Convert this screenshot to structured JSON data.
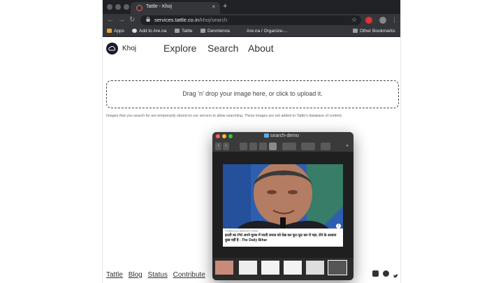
{
  "browser": {
    "tab_title": "Tattle - Khoj",
    "tab_close": "×",
    "new_tab": "+",
    "url_host": "services.tattle.co.in",
    "url_path": "/khoj/search",
    "back": "←",
    "forward": "→",
    "reload": "↻",
    "lock": "🔒",
    "star": "☆",
    "menu": "⋮",
    "bookmarks": [
      {
        "label": "Apps",
        "icon": "apps-grid-icon"
      },
      {
        "label": "Add to Are.na",
        "icon": "arena-icon"
      },
      {
        "label": "Tattle",
        "icon": "folder-icon"
      },
      {
        "label": "Denntenna",
        "icon": "folder-icon"
      },
      {
        "label": "Are.na / Organize-...",
        "icon": "page-icon"
      },
      {
        "label": "Other Bookmarks",
        "icon": "folder-icon"
      }
    ]
  },
  "site": {
    "brand": "Khoj",
    "nav": [
      "Explore",
      "Search",
      "About"
    ],
    "dropzone_text": "Drag 'n' drop your image here, or click to upload it.",
    "notice": "Images that you search for are temporarily stored on our servers to allow searching. These images are not added to Tattle's database of content.",
    "footer_links": [
      "Tattle",
      "Blog",
      "Status",
      "Contribute"
    ]
  },
  "finder": {
    "title": "search-demo",
    "back": "‹",
    "forward": "›",
    "more": "»",
    "card_source": "THEDAILYBIHAR.COM",
    "card_caption": "इटली का PM अपने मुल्क में मरती जनता को देख कर फूट-फूट कर रो पड़ा, रोने के अलावा कुछ नहीं है - The Daily Bihar",
    "info": "i"
  },
  "colors": {
    "chrome_dark": "#202124",
    "chrome_mid": "#35363a",
    "finder_bg": "#2b2b2b"
  }
}
